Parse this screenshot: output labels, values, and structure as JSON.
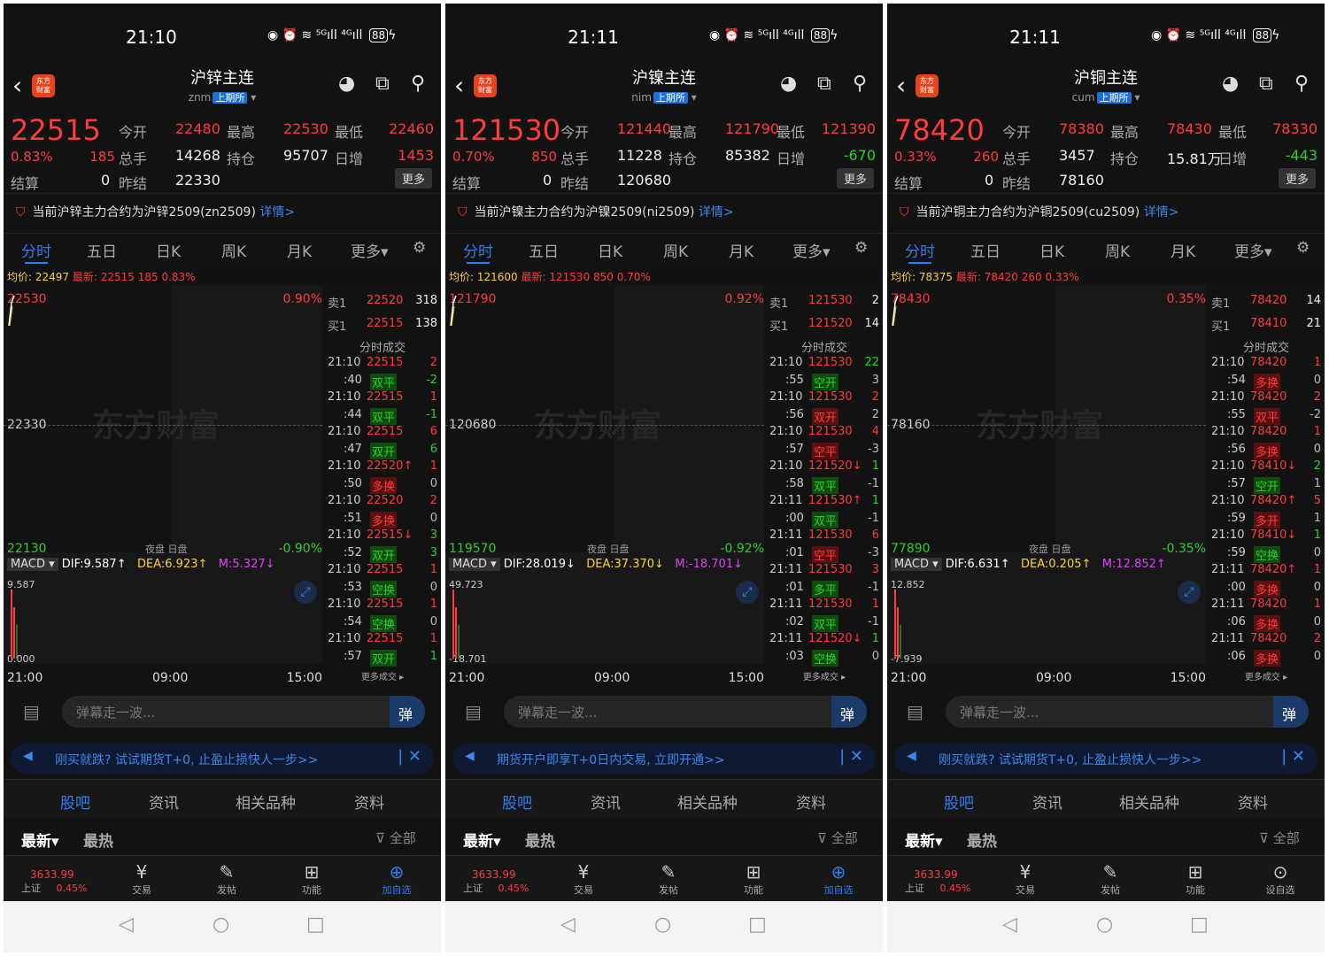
{
  "status": {
    "icons": "◉ ⏰ ≋ ⁵ᴳıll ⁴ᴳıll",
    "battery": "88",
    "charge": "ϟ"
  },
  "common": {
    "tabs": [
      "分时",
      "五日",
      "日K",
      "周K",
      "月K",
      "更多▾"
    ],
    "labels": {
      "open": "今开",
      "high": "最高",
      "low": "最低",
      "vol": "总手",
      "oi": "持仓",
      "dayinc": "日增",
      "settle": "结算",
      "prevsettle": "昨结",
      "more": "更多"
    },
    "detail_link": "详情>",
    "avg_label": "均价:",
    "last_label": "最新:",
    "night": "夜盘",
    "day": "日盘",
    "x_axis": [
      "21:00",
      "09:00",
      "15:00"
    ],
    "ob_title": "分时成交",
    "ob_more": "更多成交 ▸",
    "input_placeholder": "弹幕走一波...",
    "input_button": "弹",
    "bottom_tabs": [
      "股吧",
      "资讯",
      "相关品种",
      "资料"
    ],
    "filter": {
      "newest": "最新▾",
      "hottest": "最热",
      "all": "全部"
    },
    "index": {
      "value": "3633.99",
      "name": "上证",
      "pct": "0.45%"
    },
    "nav": [
      "交易",
      "发帖",
      "功能"
    ],
    "macd_tag": "MACD ▾",
    "sys_nav": [
      "◁",
      "○",
      "□"
    ]
  },
  "phones": [
    {
      "time": "21:10",
      "title": "沪锌主连",
      "code": "znm",
      "exchange": "上期所",
      "last": "22515",
      "pct": "0.83%",
      "change": "185",
      "open": "22480",
      "high": "22530",
      "low": "22460",
      "vol": "14268",
      "oi": "95707",
      "dayinc": "1453",
      "dayinc_color": "red",
      "settle": "0",
      "prev": "22330",
      "notice": "当前沪锌主力合约为沪锌2509(zn2509)",
      "avg": "22497",
      "avg_last": "22515  185  0.83%",
      "chart": {
        "top": "22530",
        "top_pct": "0.90%",
        "mid": "22330",
        "bottom": "22130",
        "bottom_pct": "-0.90%"
      },
      "macd": {
        "dif": "DIF:9.587↑",
        "dea": "DEA:6.923↑",
        "m": "M:5.327↓",
        "top": "9.587",
        "bottom": "0.000"
      },
      "ask": {
        "label": "卖1",
        "price": "22520",
        "qty": "318"
      },
      "bid": {
        "label": "买1",
        "price": "22515",
        "qty": "138"
      },
      "trades": [
        [
          "21:10",
          "22515",
          "2",
          "r",
          "r"
        ],
        [
          ":40",
          "双平",
          "-2",
          "g",
          "g"
        ],
        [
          "21:10",
          "22515",
          "1",
          "r",
          "r"
        ],
        [
          ":44",
          "双平",
          "-1",
          "g",
          "g"
        ],
        [
          "21:10",
          "22515",
          "6",
          "r",
          "r"
        ],
        [
          ":47",
          "双开",
          "6",
          "g",
          "g"
        ],
        [
          "21:10",
          "22520↑",
          "1",
          "r",
          "r"
        ],
        [
          ":50",
          "多换",
          "0",
          "r",
          "w"
        ],
        [
          "21:10",
          "22520",
          "2",
          "r",
          "r"
        ],
        [
          ":51",
          "多换",
          "0",
          "r",
          "w"
        ],
        [
          "21:10",
          "22515↓",
          "3",
          "r",
          "g"
        ],
        [
          ":52",
          "双开",
          "3",
          "g",
          "g"
        ],
        [
          "21:10",
          "22515",
          "1",
          "r",
          "r"
        ],
        [
          ":53",
          "空换",
          "0",
          "g",
          "w"
        ],
        [
          "21:10",
          "22515",
          "1",
          "r",
          "r"
        ],
        [
          ":54",
          "空换",
          "0",
          "g",
          "w"
        ],
        [
          "21:10",
          "22515",
          "1",
          "r",
          "r"
        ],
        [
          ":57",
          "双开",
          "1",
          "g",
          "g"
        ]
      ],
      "ad": "刚买就跌? 试试期货T+0, 止盈止损快人一步>>",
      "last_nav": "加自选",
      "last_nav_icon": "⊕"
    },
    {
      "time": "21:11",
      "title": "沪镍主连",
      "code": "nim",
      "exchange": "上期所",
      "last": "121530",
      "pct": "0.70%",
      "change": "850",
      "open": "121440",
      "high": "121790",
      "low": "121390",
      "vol": "11228",
      "oi": "85382",
      "dayinc": "-670",
      "dayinc_color": "green",
      "settle": "0",
      "prev": "120680",
      "notice": "当前沪镍主力合约为沪镍2509(ni2509)",
      "avg": "121600",
      "avg_last": "121530  850  0.70%",
      "chart": {
        "top": "121790",
        "top_pct": "0.92%",
        "mid": "120680",
        "bottom": "119570",
        "bottom_pct": "-0.92%"
      },
      "macd": {
        "dif": "DIF:28.019↓",
        "dea": "DEA:37.370↓",
        "m": "M:-18.701↓",
        "top": "49.723",
        "bottom": "-18.701"
      },
      "ask": {
        "label": "卖1",
        "price": "121530",
        "qty": "2"
      },
      "bid": {
        "label": "买1",
        "price": "121520",
        "qty": "14"
      },
      "trades": [
        [
          "21:10",
          "121530",
          "22",
          "r",
          "g"
        ],
        [
          ":55",
          "空开",
          "3",
          "g",
          "w"
        ],
        [
          "21:10",
          "121530",
          "2",
          "r",
          "r"
        ],
        [
          ":56",
          "双开",
          "2",
          "r",
          "w"
        ],
        [
          "21:10",
          "121530",
          "4",
          "r",
          "r"
        ],
        [
          ":57",
          "空平",
          "-3",
          "r",
          "w"
        ],
        [
          "21:10",
          "121520↓",
          "1",
          "r",
          "g"
        ],
        [
          ":58",
          "双平",
          "-1",
          "g",
          "w"
        ],
        [
          "21:11",
          "121530↑",
          "1",
          "r",
          "g"
        ],
        [
          ":00",
          "双平",
          "-1",
          "g",
          "w"
        ],
        [
          "21:11",
          "121530",
          "6",
          "r",
          "r"
        ],
        [
          ":01",
          "空平",
          "-3",
          "r",
          "w"
        ],
        [
          "21:11",
          "121530",
          "3",
          "r",
          "r"
        ],
        [
          ":01",
          "多平",
          "-1",
          "g",
          "w"
        ],
        [
          "21:11",
          "121530",
          "1",
          "r",
          "r"
        ],
        [
          ":02",
          "双平",
          "-1",
          "g",
          "w"
        ],
        [
          "21:11",
          "121520↓",
          "1",
          "r",
          "g"
        ],
        [
          ":03",
          "空换",
          "0",
          "g",
          "w"
        ]
      ],
      "ad": "期货开户即享T+0日内交易, 立即开通>>",
      "last_nav": "加自选",
      "last_nav_icon": "⊕"
    },
    {
      "time": "21:11",
      "title": "沪铜主连",
      "code": "cum",
      "exchange": "上期所",
      "last": "78420",
      "pct": "0.33%",
      "change": "260",
      "open": "78380",
      "high": "78430",
      "low": "78330",
      "vol": "3457",
      "oi": "15.81万",
      "dayinc": "-443",
      "dayinc_color": "green",
      "settle": "0",
      "prev": "78160",
      "notice": "当前沪铜主力合约为沪铜2509(cu2509)",
      "avg": "78375",
      "avg_last": "78420  260  0.33%",
      "chart": {
        "top": "78430",
        "top_pct": "0.35%",
        "mid": "78160",
        "bottom": "77890",
        "bottom_pct": "-0.35%"
      },
      "macd": {
        "dif": "DIF:6.631↑",
        "dea": "DEA:0.205↑",
        "m": "M:12.852↑",
        "top": "12.852",
        "bottom": "-7.939"
      },
      "ask": {
        "label": "卖1",
        "price": "78420",
        "qty": "14"
      },
      "bid": {
        "label": "买1",
        "price": "78410",
        "qty": "21"
      },
      "trades": [
        [
          "21:10",
          "78420",
          "1",
          "r",
          "r"
        ],
        [
          ":54",
          "多换",
          "0",
          "r",
          "w"
        ],
        [
          "21:10",
          "78420",
          "2",
          "r",
          "r"
        ],
        [
          ":55",
          "双平",
          "-2",
          "r",
          "w"
        ],
        [
          "21:10",
          "78420",
          "1",
          "r",
          "r"
        ],
        [
          ":56",
          "多换",
          "0",
          "r",
          "w"
        ],
        [
          "21:10",
          "78410↓",
          "2",
          "r",
          "g"
        ],
        [
          ":57",
          "空开",
          "1",
          "g",
          "w"
        ],
        [
          "21:10",
          "78420↑",
          "5",
          "r",
          "r"
        ],
        [
          ":59",
          "多开",
          "1",
          "r",
          "w"
        ],
        [
          "21:10",
          "78410↓",
          "1",
          "r",
          "g"
        ],
        [
          ":59",
          "空换",
          "0",
          "g",
          "w"
        ],
        [
          "21:11",
          "78420↑",
          "1",
          "r",
          "r"
        ],
        [
          ":00",
          "多换",
          "0",
          "r",
          "w"
        ],
        [
          "21:11",
          "78420",
          "1",
          "r",
          "r"
        ],
        [
          ":06",
          "多换",
          "0",
          "r",
          "w"
        ],
        [
          "21:11",
          "78420",
          "2",
          "r",
          "r"
        ],
        [
          ":06",
          "多换",
          "0",
          "r",
          "w"
        ]
      ],
      "ad": "刚买就跌? 试试期货T+0, 止盈止损快人一步>>",
      "last_nav": "设自选",
      "last_nav_icon": "⊙"
    }
  ]
}
